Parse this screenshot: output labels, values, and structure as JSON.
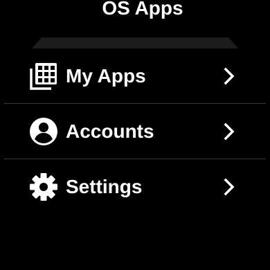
{
  "header": {
    "title": "OS Apps"
  },
  "menu": {
    "items": [
      {
        "label": "My Apps",
        "icon": "apps-grid-icon"
      },
      {
        "label": "Accounts",
        "icon": "account-circle-icon"
      },
      {
        "label": "Settings",
        "icon": "gear-icon"
      }
    ]
  },
  "colors": {
    "background": "#000000",
    "text": "#ffffff",
    "divider": "#3a3a3a",
    "shelf": "#1c1c1c"
  }
}
